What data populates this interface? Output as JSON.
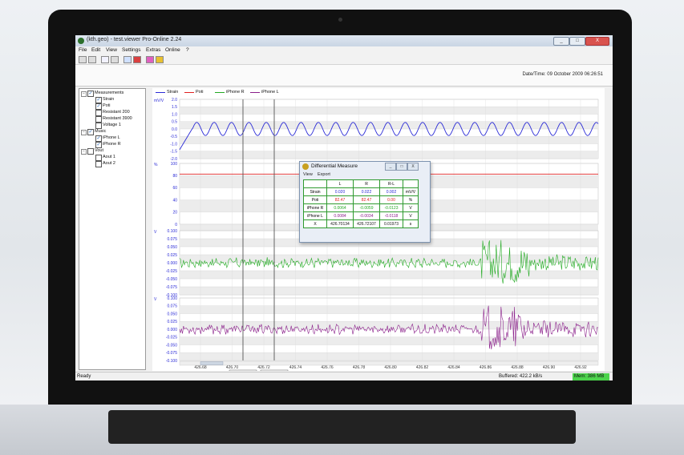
{
  "window": {
    "title": "(kth.geo) - test.viewer Pro-Online 2.24",
    "controls": [
      "_",
      "□",
      "X"
    ]
  },
  "menu": [
    "File",
    "Edit",
    "View",
    "Settings",
    "Extras",
    "Online",
    "?"
  ],
  "toolbar_icons": [
    "open-icon",
    "save-icon",
    "copy-icon",
    "print-icon",
    "grid-icon",
    "chart-icon",
    "erase-icon",
    "pin-icon"
  ],
  "datetime": "Date/Time: 09 October 2009 06:26:51",
  "tree": {
    "measurements": {
      "label": "Measurements",
      "checked": true,
      "children": [
        {
          "label": "Strain",
          "checked": true
        },
        {
          "label": "Poti",
          "checked": true
        },
        {
          "label": "Resistant 200",
          "checked": false
        },
        {
          "label": "Resistant 3900",
          "checked": false
        },
        {
          "label": "Voltage 1",
          "checked": false
        }
      ]
    },
    "music": {
      "label": "Music",
      "checked": true,
      "children": [
        {
          "label": "iPhone L",
          "checked": true
        },
        {
          "label": "iPhone R",
          "checked": true
        }
      ]
    },
    "vout": {
      "label": "Vout",
      "checked": false,
      "children": [
        {
          "label": "Aout 1",
          "checked": false
        },
        {
          "label": "Aout 2",
          "checked": false
        }
      ]
    }
  },
  "colors": {
    "strain": "#2b2bd6",
    "poti": "#e02020",
    "iphone_r": "#22aa22",
    "iphone_l": "#8a1e8a",
    "memory": "#4cd44c"
  },
  "chart_data": {
    "type": "line",
    "legend": [
      "Strain",
      "Poti",
      "iPhone R",
      "iPhone L"
    ],
    "panels": [
      {
        "unit": "mV/V",
        "yticks": [
          "2.0",
          "1.5",
          "1.0",
          "0.5",
          "0.0",
          "-0.5",
          "-1.0",
          "-1.5",
          "-2.0"
        ],
        "series": "Strain"
      },
      {
        "unit": "%",
        "yticks": [
          "100",
          "80",
          "60",
          "40",
          "20",
          "0"
        ],
        "series": "Poti"
      },
      {
        "unit": "V",
        "yticks": [
          "0.100",
          "0.075",
          "0.050",
          "0.025",
          "0.000",
          "-0.025",
          "-0.050",
          "-0.075",
          "-0.100"
        ],
        "series": "iPhone R"
      },
      {
        "unit": "V",
        "yticks": [
          "0.100",
          "0.075",
          "0.050",
          "0.025",
          "0.000",
          "-0.025",
          "-0.050",
          "-0.075",
          "-0.100"
        ],
        "series": "iPhone L"
      }
    ],
    "xticks": [
      "426.68",
      "426.70",
      "426.72",
      "426.74",
      "426.76",
      "426.78",
      "426.80",
      "426.82",
      "426.84",
      "426.86",
      "426.88",
      "426.90",
      "426.92"
    ],
    "xunit": "s",
    "cursor_labels": [
      "426.70134",
      "426.72107"
    ]
  },
  "dialog": {
    "title": "Differential Measure",
    "menu": [
      "View",
      "Export"
    ],
    "headers": [
      "",
      "L",
      "R",
      "R-L",
      ""
    ],
    "rows": [
      {
        "name": "Strain",
        "l": "0.020",
        "r": "0.022",
        "rl": "0.002",
        "unit": "mV/V",
        "color": "#2b2bd6"
      },
      {
        "name": "Poti",
        "l": "82.47",
        "r": "82.47",
        "rl": "0.00",
        "unit": "%",
        "color": "#e02020"
      },
      {
        "name": "iPhone R",
        "l": "0.0064",
        "r": "-0.0059",
        "rl": "-0.0123",
        "unit": "V",
        "color": "#22aa22"
      },
      {
        "name": "iPhone L",
        "l": "0.0084",
        "r": "-0.0034",
        "rl": "-0.0118",
        "unit": "V",
        "color": "#8a1e8a"
      },
      {
        "name": "X",
        "l": "426.70134",
        "r": "426.72107",
        "rl": "0.01973",
        "unit": "s",
        "color": "#111111"
      }
    ]
  },
  "status": {
    "left": "Ready",
    "buffered": "Buffered: 422.2 kB/s",
    "memory": "Mem: 386 MB"
  }
}
